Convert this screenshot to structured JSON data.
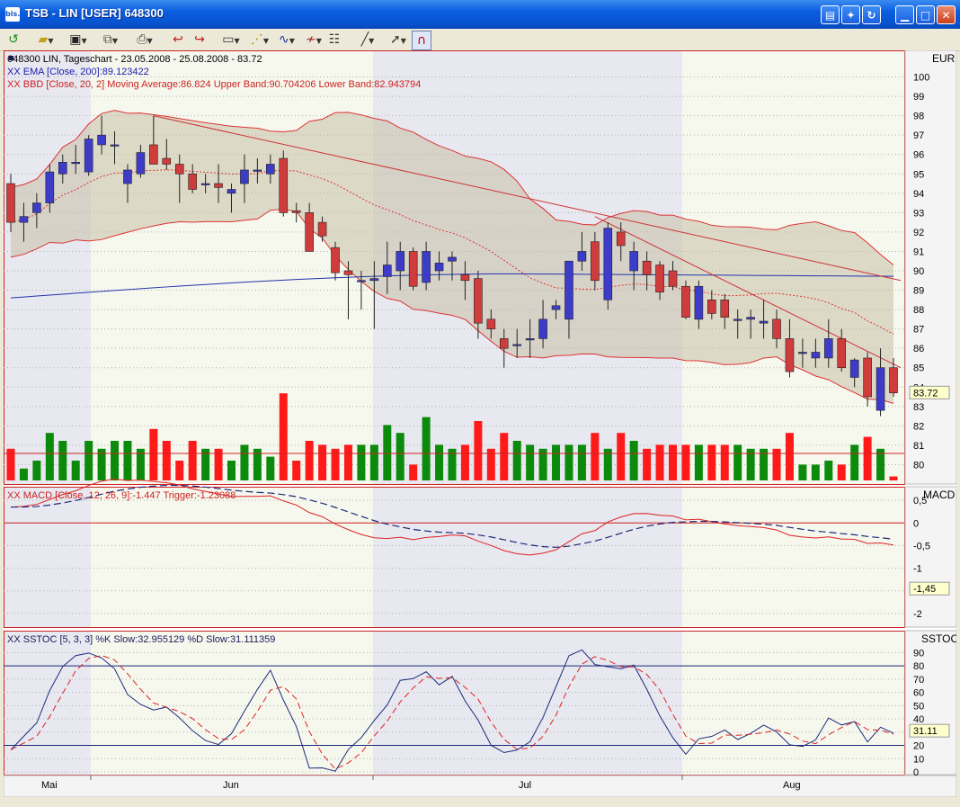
{
  "window": {
    "title": "TSB - LIN [USER] 648300",
    "app_icon": "bis.",
    "buttons": [
      "tile-icon",
      "fx-icon",
      "refresh-icon",
      "minimize-icon",
      "maximize-icon",
      "close-icon"
    ]
  },
  "toolbar": {
    "items": [
      "refresh-icon",
      "open-folder-icon",
      "save-icon",
      "copy-icon",
      "print-icon",
      "chart-back-icon",
      "chart-forward-icon",
      "chart-type-icon",
      "indicators-icon",
      "studies-icon",
      "drawing-icon",
      "properties-icon",
      "line-tool-icon",
      "pointer-icon",
      "magnet-icon"
    ]
  },
  "price_panel": {
    "title": "648300  LIN, Tageschart - 23.05.2008 - 25.08.2008 - 83.72",
    "ema_label": "XX EMA [Close, 200]:89.123422",
    "bbd_label": "XX BBD [Close, 20, 2] Moving Average:86.824 Upper Band:90.704206 Lower Band:82.943794",
    "currency": "EUR",
    "last_price": "83.72",
    "colors": {
      "up": "#3c3cc8",
      "down": "#d03c3c",
      "ema": "#2233aa",
      "band_line": "#dd3333",
      "band_fill": "#c8c0a8",
      "volume_up": "#0c8a0c",
      "volume_down": "#ff1a1a"
    }
  },
  "macd_panel": {
    "label": "XX MACD [Close, 12, 26, 9]:-1.447 Trigger:-1.23088",
    "name": "MACD",
    "last": "-1,45"
  },
  "sstoc_panel": {
    "label": "XX SSTOC [5, 3, 3] %K Slow:32.955129 %D Slow:31.111359",
    "name": "SSTOC",
    "last": "31.11"
  },
  "x_axis": {
    "months": [
      "Mai",
      "Jun",
      "Jul",
      "Aug"
    ]
  },
  "chart_data": [
    {
      "type": "candlestick",
      "title": "648300  LIN, Tageschart - 23.05.2008 - 25.08.2008 - 83.72",
      "ylabel": "EUR",
      "ylim": [
        79,
        101
      ],
      "yticks": [
        80,
        81,
        82,
        83,
        84,
        85,
        86,
        87,
        88,
        89,
        90,
        91,
        92,
        93,
        94,
        95,
        96,
        97,
        98,
        99,
        100
      ],
      "ohlc": [
        [
          94.5,
          95.0,
          92.0,
          92.5
        ],
        [
          92.5,
          93.5,
          91.5,
          92.8
        ],
        [
          93.0,
          94.0,
          92.2,
          93.5
        ],
        [
          93.5,
          95.5,
          93.0,
          95.1
        ],
        [
          95.0,
          96.0,
          94.5,
          95.6
        ],
        [
          95.6,
          96.5,
          95.0,
          95.6
        ],
        [
          95.1,
          97.0,
          94.9,
          96.8
        ],
        [
          96.5,
          98.0,
          96.0,
          97.0
        ],
        [
          96.5,
          97.2,
          95.5,
          96.5
        ],
        [
          94.5,
          95.5,
          93.5,
          95.2
        ],
        [
          95.0,
          96.5,
          94.8,
          96.1
        ],
        [
          96.5,
          98.0,
          96.0,
          95.5
        ],
        [
          95.8,
          96.8,
          95.2,
          95.5
        ],
        [
          95.5,
          96.0,
          93.5,
          95.0
        ],
        [
          95.0,
          95.5,
          94.0,
          94.2
        ],
        [
          94.5,
          95.0,
          94.0,
          94.5
        ],
        [
          94.5,
          95.5,
          93.5,
          94.3
        ],
        [
          94.0,
          94.5,
          93.0,
          94.2
        ],
        [
          94.5,
          96.0,
          93.5,
          95.2
        ],
        [
          95.2,
          95.8,
          94.5,
          95.2
        ],
        [
          95.0,
          96.0,
          94.5,
          95.5
        ],
        [
          95.8,
          96.2,
          92.8,
          93.0
        ],
        [
          93.1,
          93.5,
          92.5,
          93.0
        ],
        [
          93.0,
          93.5,
          91.5,
          91.0
        ],
        [
          92.5,
          92.8,
          91.5,
          91.8
        ],
        [
          91.2,
          91.5,
          89.5,
          89.9
        ],
        [
          90.0,
          90.5,
          87.5,
          89.8
        ],
        [
          89.5,
          90.0,
          88.0,
          89.5
        ],
        [
          89.5,
          90.5,
          87.0,
          89.6
        ],
        [
          89.7,
          91.5,
          88.8,
          90.3
        ],
        [
          90.0,
          91.5,
          89.0,
          91.0
        ],
        [
          91.0,
          91.2,
          89.0,
          89.2
        ],
        [
          89.4,
          91.5,
          89.0,
          91.0
        ],
        [
          90.0,
          91.0,
          89.5,
          90.4
        ],
        [
          90.5,
          91.0,
          89.5,
          90.7
        ],
        [
          89.8,
          90.5,
          88.5,
          89.5
        ],
        [
          89.6,
          90.0,
          86.5,
          87.3
        ],
        [
          87.5,
          88.0,
          86.5,
          87.0
        ],
        [
          86.5,
          87.0,
          85.0,
          86.0
        ],
        [
          86.2,
          87.0,
          85.5,
          86.2
        ],
        [
          86.5,
          87.5,
          85.5,
          86.5
        ],
        [
          86.5,
          88.5,
          86.0,
          87.5
        ],
        [
          88.0,
          88.5,
          87.5,
          88.2
        ],
        [
          87.5,
          90.5,
          86.5,
          90.5
        ],
        [
          90.5,
          92.0,
          90.0,
          91.0
        ],
        [
          91.5,
          92.0,
          89.0,
          89.5
        ],
        [
          88.5,
          92.5,
          88.0,
          92.2
        ],
        [
          92.0,
          92.5,
          90.5,
          91.3
        ],
        [
          90.0,
          91.5,
          89.0,
          91.0
        ],
        [
          90.5,
          91.0,
          89.0,
          89.8
        ],
        [
          90.3,
          90.5,
          88.5,
          88.9
        ],
        [
          90.0,
          90.5,
          89.0,
          89.2
        ],
        [
          89.2,
          89.5,
          87.5,
          87.6
        ],
        [
          87.5,
          89.5,
          87.0,
          89.2
        ],
        [
          88.5,
          89.0,
          87.5,
          87.8
        ],
        [
          88.5,
          88.8,
          87.0,
          87.6
        ],
        [
          87.5,
          88.0,
          86.5,
          87.5
        ],
        [
          87.5,
          88.0,
          86.5,
          87.6
        ],
        [
          87.3,
          88.5,
          86.5,
          87.4
        ],
        [
          87.5,
          88.0,
          86.0,
          86.5
        ],
        [
          86.5,
          87.5,
          84.5,
          84.8
        ],
        [
          85.8,
          86.5,
          85.0,
          85.8
        ],
        [
          85.5,
          86.5,
          85.0,
          85.8
        ],
        [
          85.5,
          87.5,
          85.0,
          86.5
        ],
        [
          86.5,
          87.0,
          84.8,
          85.0
        ],
        [
          84.5,
          85.5,
          84.0,
          85.4
        ],
        [
          85.5,
          85.8,
          83.0,
          83.5
        ],
        [
          82.8,
          86.0,
          82.5,
          85.0
        ],
        [
          85.0,
          85.5,
          83.5,
          83.7
        ]
      ]
    },
    {
      "type": "line",
      "title": "XX MACD [Close, 12, 26, 9]:-1.447 Trigger:-1.23088",
      "ylim": [
        -2.3,
        0.8
      ],
      "yticks": [
        "0,5",
        "0",
        "-0,5",
        "-1",
        "-1,5",
        "-2"
      ]
    },
    {
      "type": "line",
      "title": "XX SSTOC [5, 3, 3] %K Slow:32.955129 %D Slow:31.111359",
      "ylim": [
        0,
        95
      ],
      "yticks": [
        90,
        80,
        70,
        60,
        50,
        40,
        30,
        20,
        10,
        0
      ]
    }
  ]
}
